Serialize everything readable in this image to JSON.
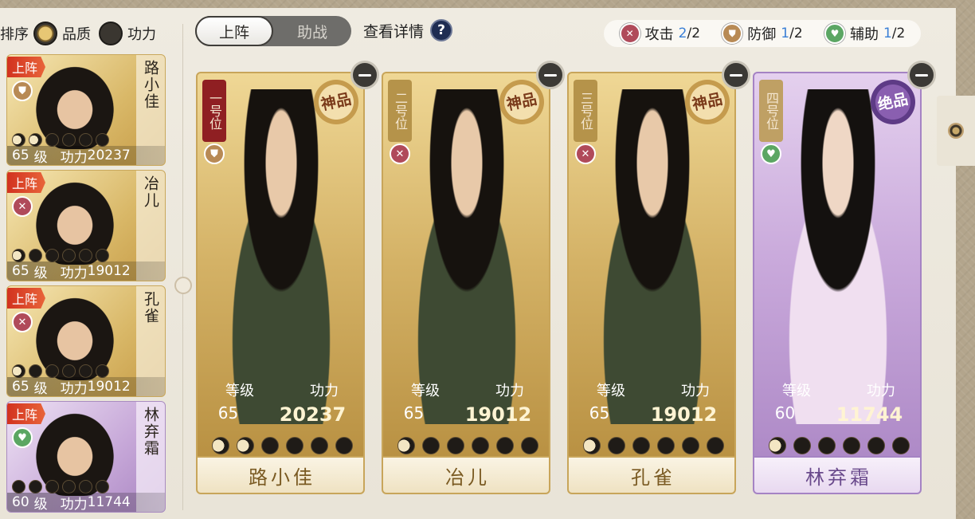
{
  "sort": {
    "label": "排序",
    "quality_label": "品质",
    "power_label": "功力"
  },
  "tabs": {
    "deploy": "上阵",
    "assist": "助战"
  },
  "details_label": "查看详情",
  "help_glyph": "?",
  "counts": {
    "attack": {
      "label": "攻击",
      "current": "2",
      "max": "/2"
    },
    "defense": {
      "label": "防御",
      "current": "1",
      "max": "/2"
    },
    "support": {
      "label": "辅助",
      "current": "1",
      "max": "/2"
    }
  },
  "hero_list": [
    {
      "tag": "上阵",
      "name": "路小佳",
      "role": "defense",
      "level": "65",
      "level_label": "级",
      "power_label": "功力",
      "power": "20237",
      "stars": [
        1,
        1,
        0,
        0,
        0,
        0
      ],
      "frame": "gold"
    },
    {
      "tag": "上阵",
      "name": "冶儿",
      "role": "attack",
      "level": "65",
      "level_label": "级",
      "power_label": "功力",
      "power": "19012",
      "stars": [
        1,
        0,
        0,
        0,
        0,
        0
      ],
      "frame": "gold"
    },
    {
      "tag": "上阵",
      "name": "孔雀",
      "role": "attack",
      "level": "65",
      "level_label": "级",
      "power_label": "功力",
      "power": "19012",
      "stars": [
        1,
        0,
        0,
        0,
        0,
        0
      ],
      "frame": "gold"
    },
    {
      "tag": "上阵",
      "name": "林弃霜",
      "role": "support",
      "level": "60",
      "level_label": "级",
      "power_label": "功力",
      "power": "11744",
      "stars": [
        0,
        0,
        0,
        0,
        0,
        0
      ],
      "frame": "purple"
    }
  ],
  "cards": [
    {
      "position": "一号位",
      "grade": "神品",
      "role": "defense",
      "level_label": "等级",
      "power_label": "功力",
      "level": "65",
      "power": "20237",
      "stars": [
        1,
        1,
        0,
        0,
        0,
        0
      ],
      "name": "路小佳",
      "frame": "gold"
    },
    {
      "position": "二号位",
      "grade": "神品",
      "role": "attack",
      "level_label": "等级",
      "power_label": "功力",
      "level": "65",
      "power": "19012",
      "stars": [
        1,
        0,
        0,
        0,
        0,
        0
      ],
      "name": "冶儿",
      "frame": "gold"
    },
    {
      "position": "三号位",
      "grade": "神品",
      "role": "attack",
      "level_label": "等级",
      "power_label": "功力",
      "level": "65",
      "power": "19012",
      "stars": [
        1,
        0,
        0,
        0,
        0,
        0
      ],
      "name": "孔雀",
      "frame": "gold"
    },
    {
      "position": "四号位",
      "grade": "绝品",
      "role": "support",
      "level_label": "等级",
      "power_label": "功力",
      "level": "60",
      "power": "11744",
      "stars": [
        1,
        0,
        0,
        0,
        0,
        0
      ],
      "name": "林弃霜",
      "frame": "purple"
    }
  ],
  "icons": {
    "defense": "shield-icon",
    "attack": "crossed-swords-icon",
    "support": "heart-icon"
  },
  "colors": {
    "accent_blue": "#3a7fd6",
    "deploy_red": "#d2321f",
    "gold_frame": "#c8a55a",
    "purple_frame": "#a583c4"
  }
}
